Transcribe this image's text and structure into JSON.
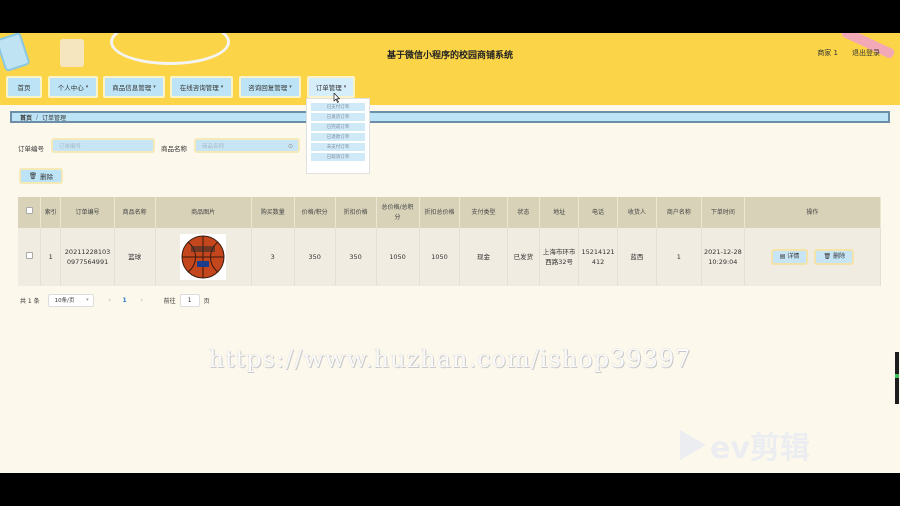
{
  "header": {
    "title": "基于微信小程序的校园商铺系统",
    "user": "商家 1",
    "logout": "退出登录"
  },
  "nav": {
    "items": [
      {
        "label": "首页",
        "has_dropdown": false
      },
      {
        "label": "个人中心",
        "has_dropdown": true
      },
      {
        "label": "商品信息管理",
        "has_dropdown": true
      },
      {
        "label": "在线咨询管理",
        "has_dropdown": true
      },
      {
        "label": "咨询回复管理",
        "has_dropdown": true
      },
      {
        "label": "订单管理",
        "has_dropdown": true
      }
    ],
    "chevron": "▾",
    "dropdown": [
      "已支付订单",
      "已发货订单",
      "已完成订单",
      "已退款订单",
      "未支付订单",
      "已取消订单"
    ]
  },
  "breadcrumb": {
    "home": "首页",
    "separator": "/",
    "current": "订单管理"
  },
  "search": {
    "order_no_label": "订单编号",
    "order_no_placeholder": "订单编号",
    "product_name_label": "商品名称",
    "product_name_placeholder": "商品名称",
    "search_button": "查询"
  },
  "toolbar": {
    "delete_label": "删除"
  },
  "table": {
    "columns": [
      "索引",
      "订单编号",
      "商品名称",
      "商品图片",
      "购买数量",
      "价格/积分",
      "折扣价格",
      "总价格/总积分",
      "折扣总价格",
      "支付类型",
      "状态",
      "地址",
      "电话",
      "收货人",
      "商户名称",
      "下单时间",
      "操作"
    ],
    "rows": [
      {
        "index": "1",
        "order_no": "2021122810309775649 91",
        "order_no_display": "202112281030977564991",
        "product_name": "篮球",
        "product_image": "basketball",
        "quantity": "3",
        "price": "350",
        "discount_price": "350",
        "total": "1050",
        "discount_total": "1050",
        "pay_type": "现金",
        "status": "已发货",
        "address": "上海市环市西路32号",
        "phone": "15214121412",
        "receiver": "蓝西",
        "merchant": "1",
        "order_time": "2021-12-28 10:29:04",
        "detail_button": "详情",
        "delete_button": "删除"
      }
    ]
  },
  "pager": {
    "total": "共 1 条",
    "page_size": "10条/页",
    "current_page": "1",
    "goto_label": "前往",
    "goto_value": "1",
    "page_unit": "页",
    "prev": "‹",
    "next": "›"
  },
  "watermark": {
    "url": "https://www.huzhan.com/ishop39397",
    "ev": "ev剪辑"
  },
  "colors": {
    "header_bg": "#fbd547",
    "button_bg": "#bde4f6",
    "page_bg": "#fdf8ec",
    "table_header_bg": "#d7d2b8"
  }
}
